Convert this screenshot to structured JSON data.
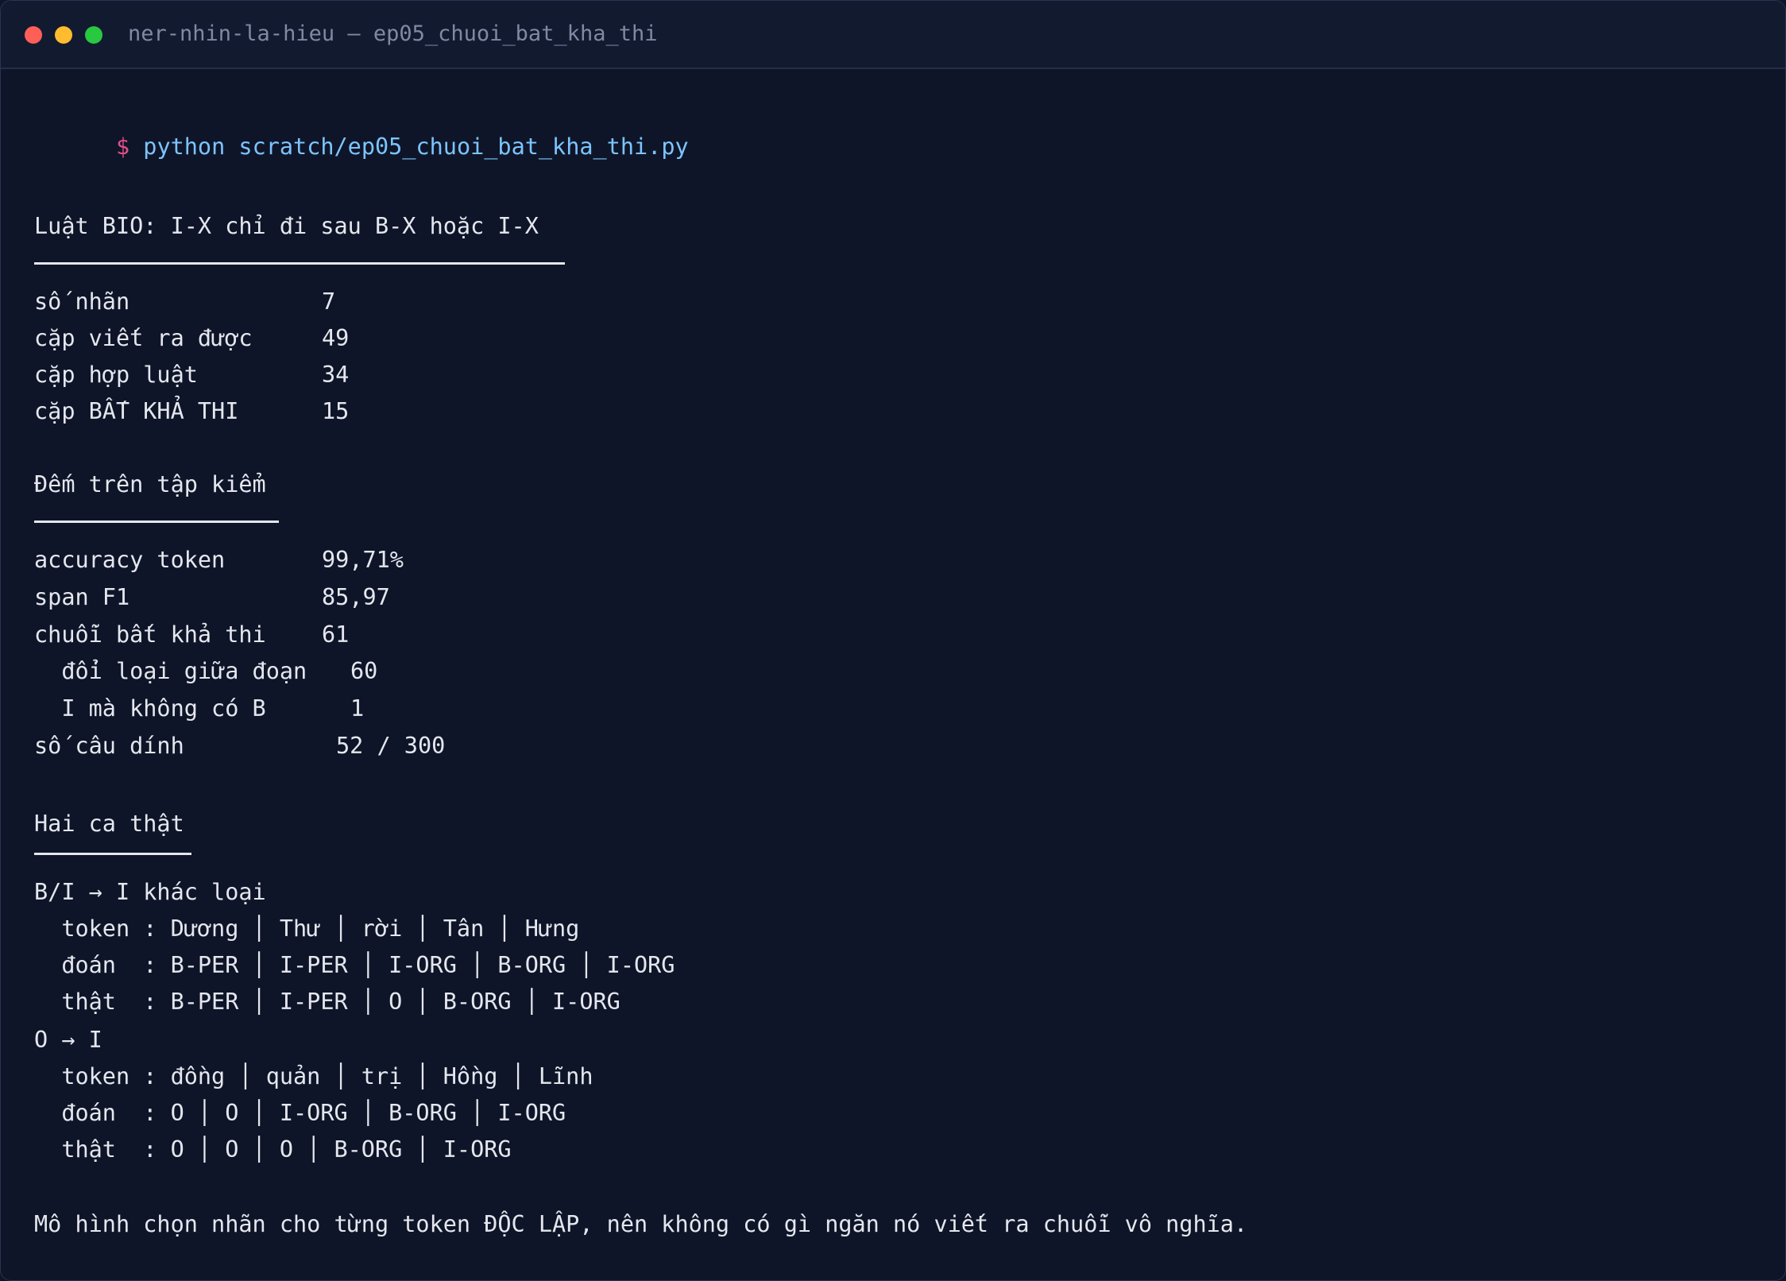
{
  "window": {
    "title": "ner-nhin-la-hieu — ep05_chuoi_bat_kha_thi",
    "buttons": {
      "close_color": "#ff5f57",
      "minimize_color": "#febc2e",
      "zoom_color": "#28c840"
    }
  },
  "command": {
    "prompt": "$",
    "text": "python scratch/ep05_chuoi_bat_kha_thi.py"
  },
  "section1": {
    "heading": "Luật BIO: I-X chỉ đi sau B-X hoặc I-X",
    "rows": [
      {
        "label": "số nhãn",
        "value": "7"
      },
      {
        "label": "cặp viết ra được",
        "value": "49"
      },
      {
        "label": "cặp hợp luật",
        "value": "34"
      },
      {
        "label": "cặp BẤT KHẢ THI",
        "value": "15"
      }
    ]
  },
  "section2": {
    "heading": "Đếm trên tập kiểm",
    "rows": [
      {
        "label": "accuracy token",
        "value": "99,71%"
      },
      {
        "label": "span F1",
        "value": "85,97"
      },
      {
        "label": "chuỗi bất khả thi",
        "value": "61"
      },
      {
        "label": "  đổi loại giữa đoạn",
        "value": "60"
      },
      {
        "label": "  I mà không có B",
        "value": "1"
      },
      {
        "label": "số câu dính",
        "value": "52 / 300"
      }
    ]
  },
  "section3": {
    "heading": "Hai ca thật",
    "lines": [
      "B/I → I khác loại",
      "  token : Dương │ Thư │ rời │ Tân │ Hưng",
      "  đoán  : B-PER │ I-PER │ I-ORG │ B-ORG │ I-ORG",
      "  thật  : B-PER │ I-PER │ O │ B-ORG │ I-ORG",
      "O → I",
      "  token : đồng │ quản │ trị │ Hồng │ Lĩnh",
      "  đoán  : O │ O │ I-ORG │ B-ORG │ I-ORG",
      "  thật  : O │ O │ O │ B-ORG │ I-ORG"
    ]
  },
  "footer": {
    "text": "Mô hình chọn nhãn cho từng token ĐỘC LẬP, nên không có gì ngăn nó viết ra chuỗi vô nghĩa."
  }
}
